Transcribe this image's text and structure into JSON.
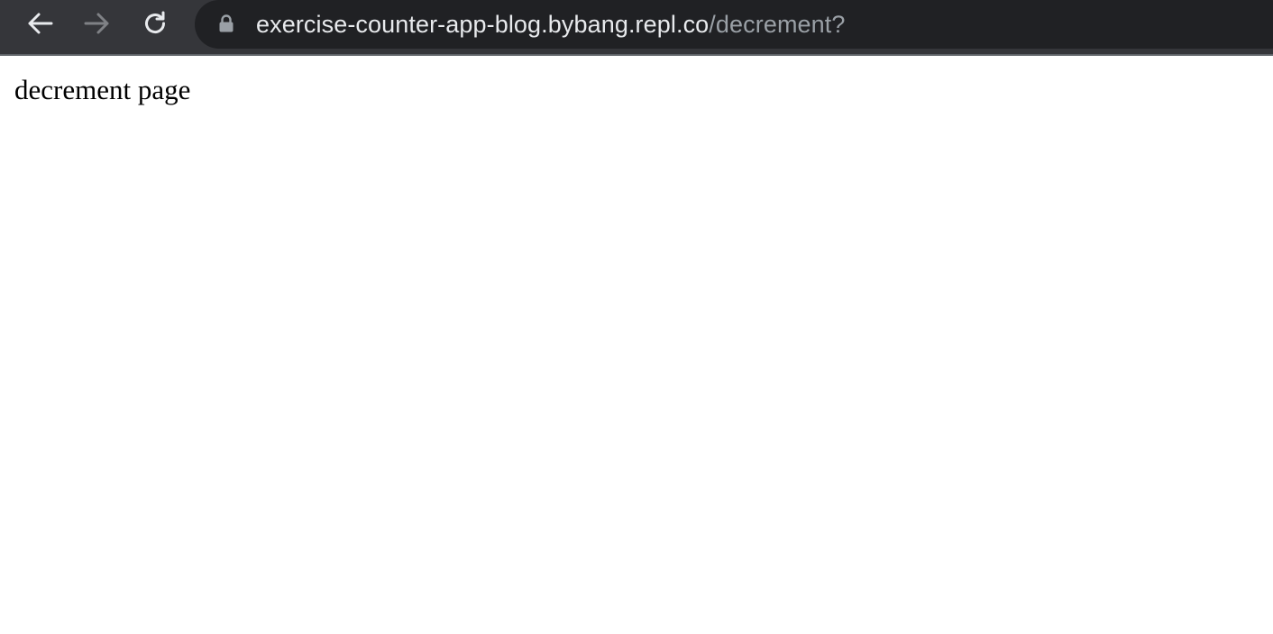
{
  "browser": {
    "url_host": "exercise-counter-app-blog.bybang.repl.co",
    "url_path": "/decrement?",
    "icons": {
      "back": "arrow-left-icon",
      "forward": "arrow-right-icon",
      "reload": "reload-icon",
      "lock": "lock-icon"
    },
    "colors": {
      "toolbar": "#35363a",
      "omnibox": "#202124",
      "url_host_text": "#e8eaed",
      "url_path_text": "#9aa0a6",
      "forward_disabled": "#7f8185"
    }
  },
  "page": {
    "body_text": "decrement page"
  }
}
